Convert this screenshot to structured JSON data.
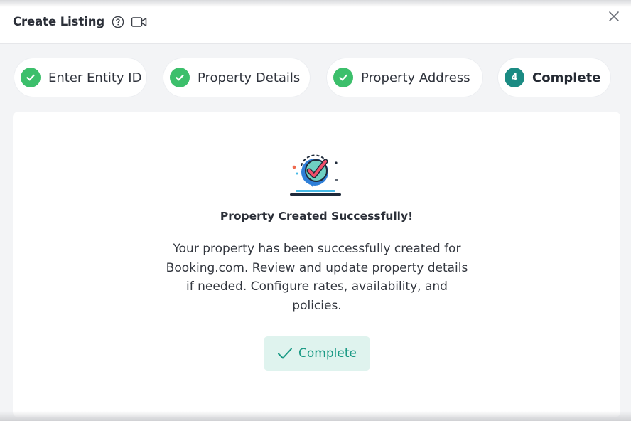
{
  "header": {
    "title": "Create Listing",
    "help_icon": "help-circle-icon",
    "video_icon": "video-camera-icon",
    "close_icon": "close-icon"
  },
  "stepper": {
    "steps": [
      {
        "label": "Enter Entity ID",
        "status": "done"
      },
      {
        "label": "Property Details",
        "status": "done"
      },
      {
        "label": "Property Address",
        "status": "done"
      },
      {
        "label": "Complete",
        "status": "current",
        "number": "4"
      }
    ]
  },
  "result": {
    "illustration_icon": "success-check-badge-icon",
    "title": "Property Created Successfully!",
    "message": "Your property has been successfully created for Booking.com. Review and update property details if needed. Configure rates, availability, and policies.",
    "button_label": "Complete"
  },
  "colors": {
    "accent": "#1b8b83",
    "done": "#3cbf6b",
    "button_bg": "#dff3ee",
    "button_text": "#1b9a85"
  }
}
